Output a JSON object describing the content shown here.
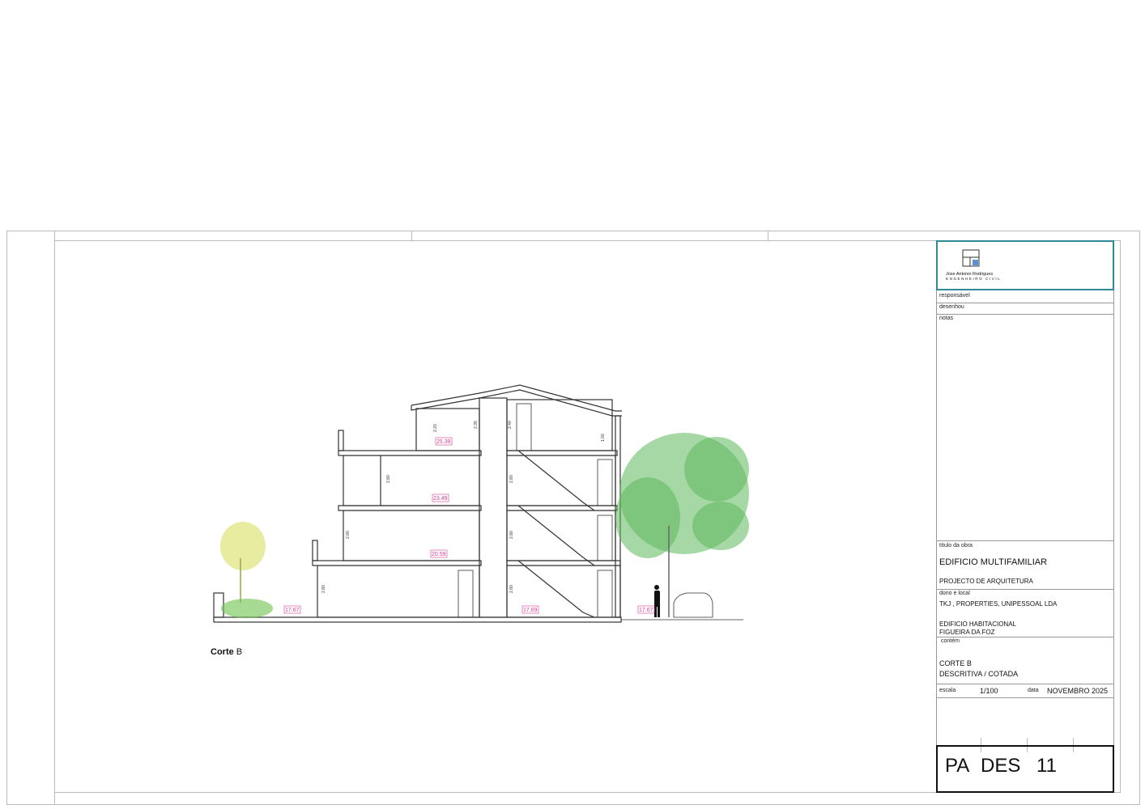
{
  "drawing": {
    "caption_bold": "Corte",
    "caption_rest": " B",
    "levels": [
      "25.39",
      "23.49",
      "20.59",
      "17.67",
      "17.69",
      "17.67"
    ],
    "heights": [
      "2.20",
      "2.35",
      "2.40",
      "2.80",
      "2.80",
      "2.80",
      "2.80",
      "2.80",
      "2.80",
      "1.00"
    ],
    "colors": {
      "level_tag": "#d63b9a",
      "tree": "#4caf50",
      "shrub": "#c8d84a",
      "line": "#333333"
    }
  },
  "titleblock": {
    "logo_name": "Jose Antonio Rodrigues",
    "logo_sub": "ENGENHEIRO CIVIL",
    "responsavel_label": "responsável",
    "desenhou_label": "desenhou",
    "notas_label": "notas",
    "titulo_label": "título da obra",
    "titulo_value": "EDIFICIO MULTIFAMILIAR",
    "projecto_value": "PROJECTO DE ARQUITETURA",
    "dono_label": "dono e local",
    "dono_value": "TKJ , PROPERTIES, UNIPESSOAL LDA",
    "local_line1": "EDIFICIO HABITACIONAL",
    "local_line2": "FIGUEIRA DA FOZ",
    "contem_label": "contém",
    "contem_line1": "CORTE B",
    "contem_line2": "DESCRITIVA / COTADA",
    "escala_label": "escala",
    "escala_value": "1/100",
    "data_label": "data",
    "data_value": "NOVEMBRO 2025",
    "code_1": "PA",
    "code_2": "DES",
    "code_3": "11"
  }
}
